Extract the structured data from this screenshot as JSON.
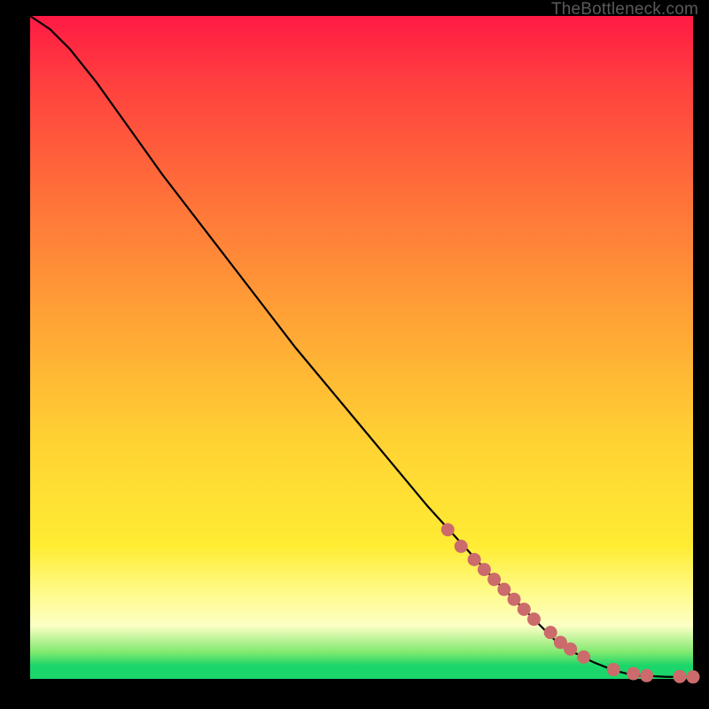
{
  "attribution": "TheBottleneck.com",
  "colors": {
    "curve": "#000000",
    "marker_fill": "#cc6b6b",
    "marker_stroke": "#cc6b6b",
    "background_top": "#ff1a44",
    "background_bottom": "#1bd66a"
  },
  "chart_data": {
    "type": "line",
    "title": "",
    "xlabel": "",
    "ylabel": "",
    "xlim": [
      0,
      100
    ],
    "ylim": [
      0,
      100
    ],
    "grid": false,
    "legend": false,
    "series": [
      {
        "name": "curve",
        "style": "line",
        "x": [
          0,
          3,
          6,
          10,
          15,
          20,
          30,
          40,
          50,
          60,
          70,
          80,
          85,
          88,
          90,
          92,
          94,
          96,
          100
        ],
        "y": [
          100,
          98,
          95,
          90,
          83,
          76,
          63,
          50,
          38,
          26,
          15,
          5,
          2.5,
          1.3,
          0.8,
          0.5,
          0.4,
          0.3,
          0.3
        ]
      },
      {
        "name": "markers",
        "style": "scatter",
        "x": [
          63,
          65,
          67,
          68.5,
          70,
          71.5,
          73,
          74.5,
          76,
          78.5,
          80,
          81.5,
          83.5,
          88,
          91,
          93,
          98,
          100
        ],
        "y": [
          22.5,
          20,
          18,
          16.5,
          15,
          13.5,
          12,
          10.5,
          9,
          7,
          5.5,
          4.5,
          3.3,
          1.4,
          0.8,
          0.5,
          0.35,
          0.3
        ]
      }
    ]
  }
}
